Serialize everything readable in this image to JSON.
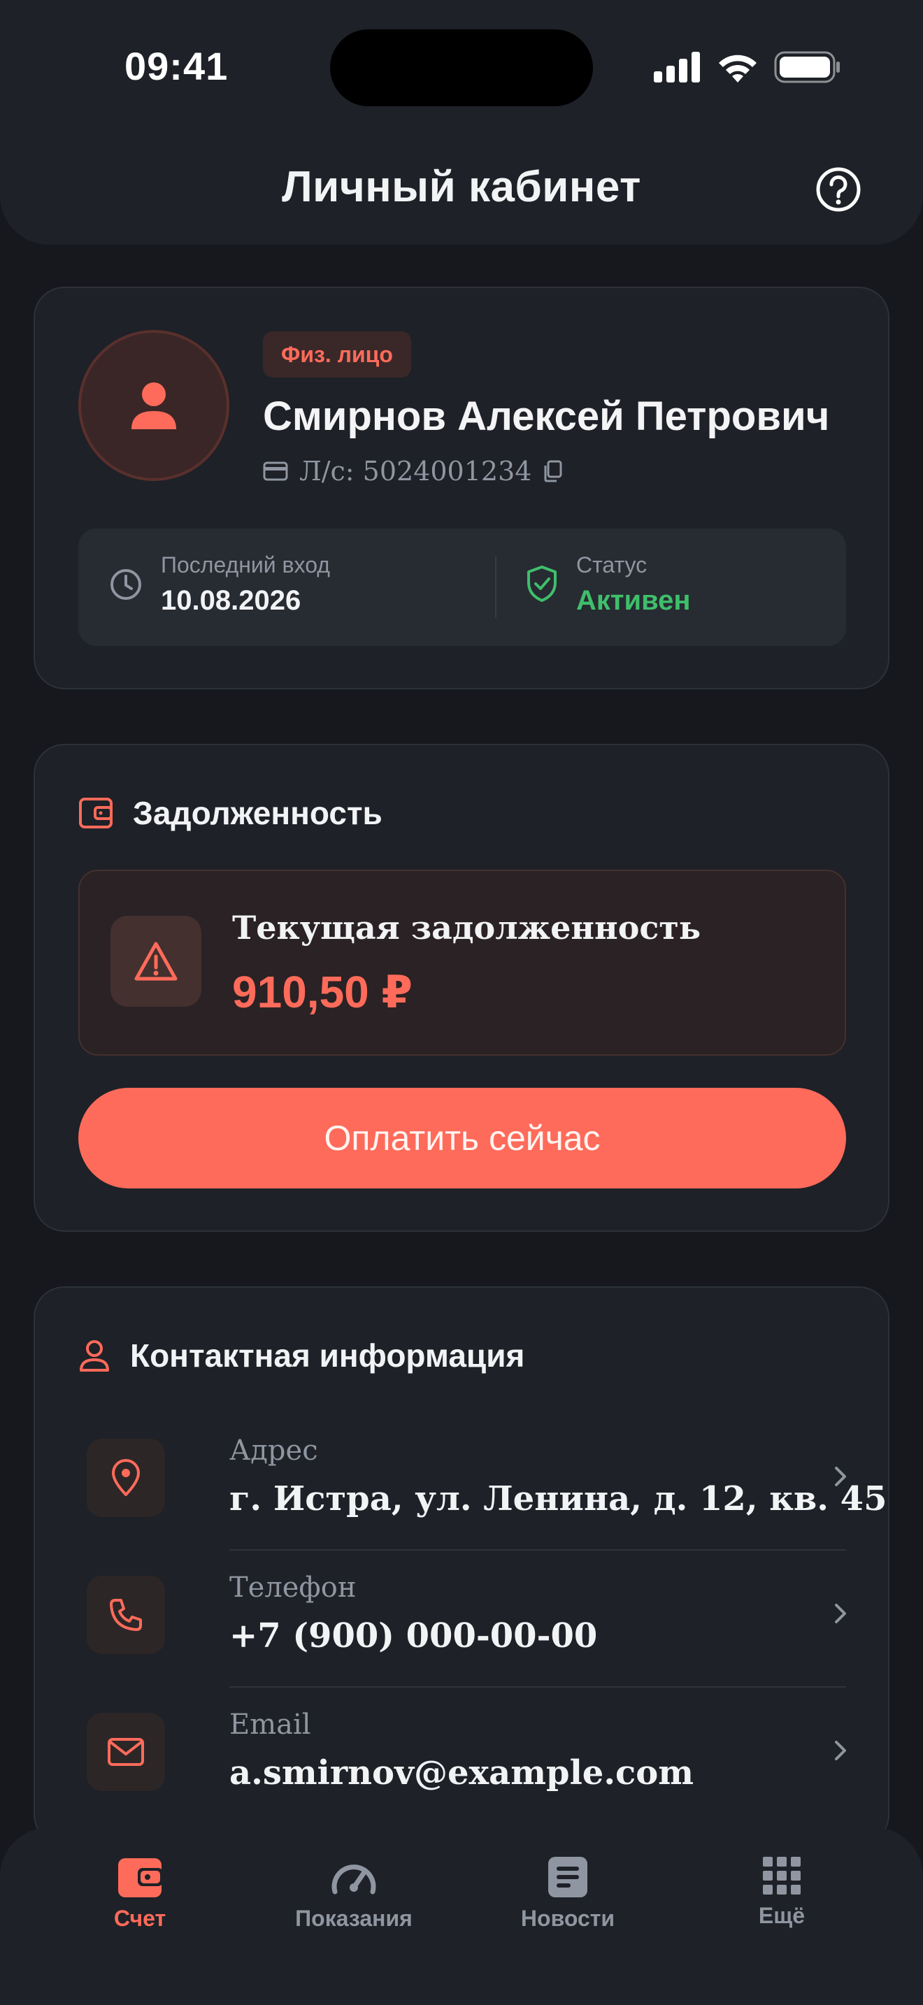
{
  "status_bar": {
    "time": "09:41"
  },
  "header": {
    "title": "Личный кабинет"
  },
  "profile": {
    "badge": "Физ. лицо",
    "name": "Смирнов Алексей Петрович",
    "account": "Л/с: 5024001234",
    "last_login_label": "Последний вход",
    "last_login_value": "10.08.2026",
    "status_label": "Статус",
    "status_value": "Активен"
  },
  "debt": {
    "section_title": "Задолженность",
    "label": "Текущая задолженность",
    "amount": "910,50 ₽",
    "pay_button": "Оплатить сейчас"
  },
  "contacts": {
    "section_title": "Контактная информация",
    "items": [
      {
        "label": "Адрес",
        "value": "г. Истра, ул. Ленина, д. 12, кв. 45",
        "icon": "map-pin-icon"
      },
      {
        "label": "Телефон",
        "value": "+7 (900) 000-00-00",
        "icon": "phone-icon"
      },
      {
        "label": "Email",
        "value": "a.smirnov@example.com",
        "icon": "mail-icon"
      }
    ]
  },
  "tabbar": {
    "tabs": [
      {
        "label": "Счет",
        "icon": "wallet-icon",
        "active": true
      },
      {
        "label": "Показания",
        "icon": "gauge-icon",
        "active": false
      },
      {
        "label": "Новости",
        "icon": "news-icon",
        "active": false
      },
      {
        "label": "Ещё",
        "icon": "grid-icon",
        "active": false
      }
    ]
  },
  "colors": {
    "accent": "#ff6b5a",
    "success": "#3fbf6b",
    "background": "#16181d",
    "card": "#1e2127"
  }
}
